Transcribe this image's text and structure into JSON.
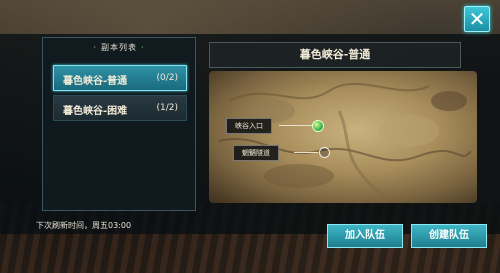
{
  "close_icon": "close-icon",
  "dungeon_list": {
    "title": "副本列表",
    "items": [
      {
        "name": "暮色峡谷-普通",
        "count": "(0/2)",
        "selected": true
      },
      {
        "name": "暮色峡谷-困难",
        "count": "(1/2)",
        "selected": false
      }
    ]
  },
  "detail": {
    "title": "暮色峡谷-普通",
    "markers": [
      {
        "label": "峡谷入口",
        "state": "active"
      },
      {
        "label": "魍魉隧道",
        "state": "inactive"
      }
    ]
  },
  "refresh_text": "下次刷新时间，周五03:00",
  "buttons": {
    "join": "加入队伍",
    "create": "创建队伍"
  },
  "colors": {
    "accent": "#2f92a8",
    "active_marker": "#3db34a"
  }
}
